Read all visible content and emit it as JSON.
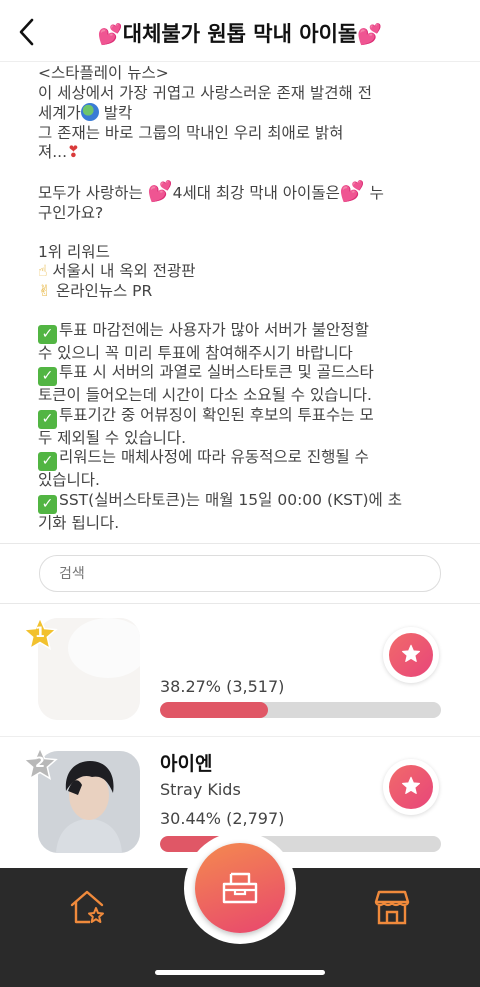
{
  "header": {
    "title": "대체불가 원톱 막내 아이돌",
    "heart_left": "💕",
    "heart_right": "💕"
  },
  "notice": {
    "source": "<스타플레이 뉴스>",
    "line1": "이 세상에서 가장 귀엽고 사랑스러운 존재 발견해 전",
    "line2a": "세계가",
    "line2b": " 발칵",
    "line3": "그 존재는 바로 그룹의 막내인 우리 최애로 밝혀",
    "line4a": "져...",
    "line4b": "❣",
    "q_a": "모두가 사랑하는 ",
    "q_heart": "💕",
    "q_b": "4세대 최강 막내 아이돌은",
    "q_c": " 누",
    "q_line2": "구인가요?",
    "reward_title": "1위 리워드",
    "reward1_icon": "☝",
    "reward1": "서울시 내 옥외 전광판",
    "reward2_icon": "✌",
    "reward2": "온라인뉴스 PR",
    "check_mark": "✓",
    "rule1a": "투표 마감전에는 사용자가 많아 서버가 불안정할",
    "rule1b": "수 있으니 꼭 미리 투표에 참여해주시기 바랍니다",
    "rule2a": "투표 시 서버의 과열로 실버스타토큰 및 골드스타",
    "rule2b": "토큰이 들어오는데 시간이 다소 소요될 수 있습니다.",
    "rule3a": "투표기간 중 어뷰징이 확인된 후보의 투표수는 모",
    "rule3b": "두 제외될 수 있습니다.",
    "rule4a": "리워드는 매체사정에 따라 유동적으로 진행될 수",
    "rule4b": "있습니다.",
    "rule5a": "SST(실버스타토큰)는 매월 15일 00:00 (KST)에 초",
    "rule5b": "기화 됩니다."
  },
  "search": {
    "placeholder": "검색"
  },
  "ranking": [
    {
      "rank": "1",
      "name": "",
      "group": "",
      "percent_text": "38.27% (3,517)",
      "percent": 38.27,
      "badge_color": "#f2c12e"
    },
    {
      "rank": "2",
      "name": "아이엔",
      "group": "Stray Kids",
      "percent_text": "30.44% (2,797)",
      "percent": 30.44,
      "badge_color": "#b8b8b8"
    }
  ],
  "colors": {
    "accent": "#e8467a",
    "bar": "#e05766",
    "nav_bg": "#2a2a2a",
    "nav_icon": "#f08a3c"
  },
  "icons": {
    "back": "chevron-left-icon",
    "vote": "star-icon",
    "home": "home-star-icon",
    "center": "ballot-box-icon",
    "shop": "store-icon"
  }
}
